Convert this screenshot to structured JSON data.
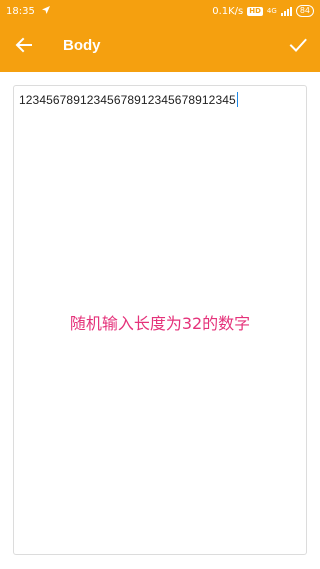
{
  "status_bar": {
    "time": "18:35",
    "net_speed": "0.1K/s",
    "hd_badge": "HD",
    "network_type": "4G",
    "battery": "84"
  },
  "app_bar": {
    "title": "Body",
    "back_icon": "arrow-left-icon",
    "done_icon": "check-icon"
  },
  "editor": {
    "value": "12345678912345678912345678912345"
  },
  "annotation": {
    "text": "随机输入长度为32的数字"
  },
  "colors": {
    "accent": "#f5a00f",
    "annotation": "#e5327a",
    "caret": "#1e88e5"
  }
}
